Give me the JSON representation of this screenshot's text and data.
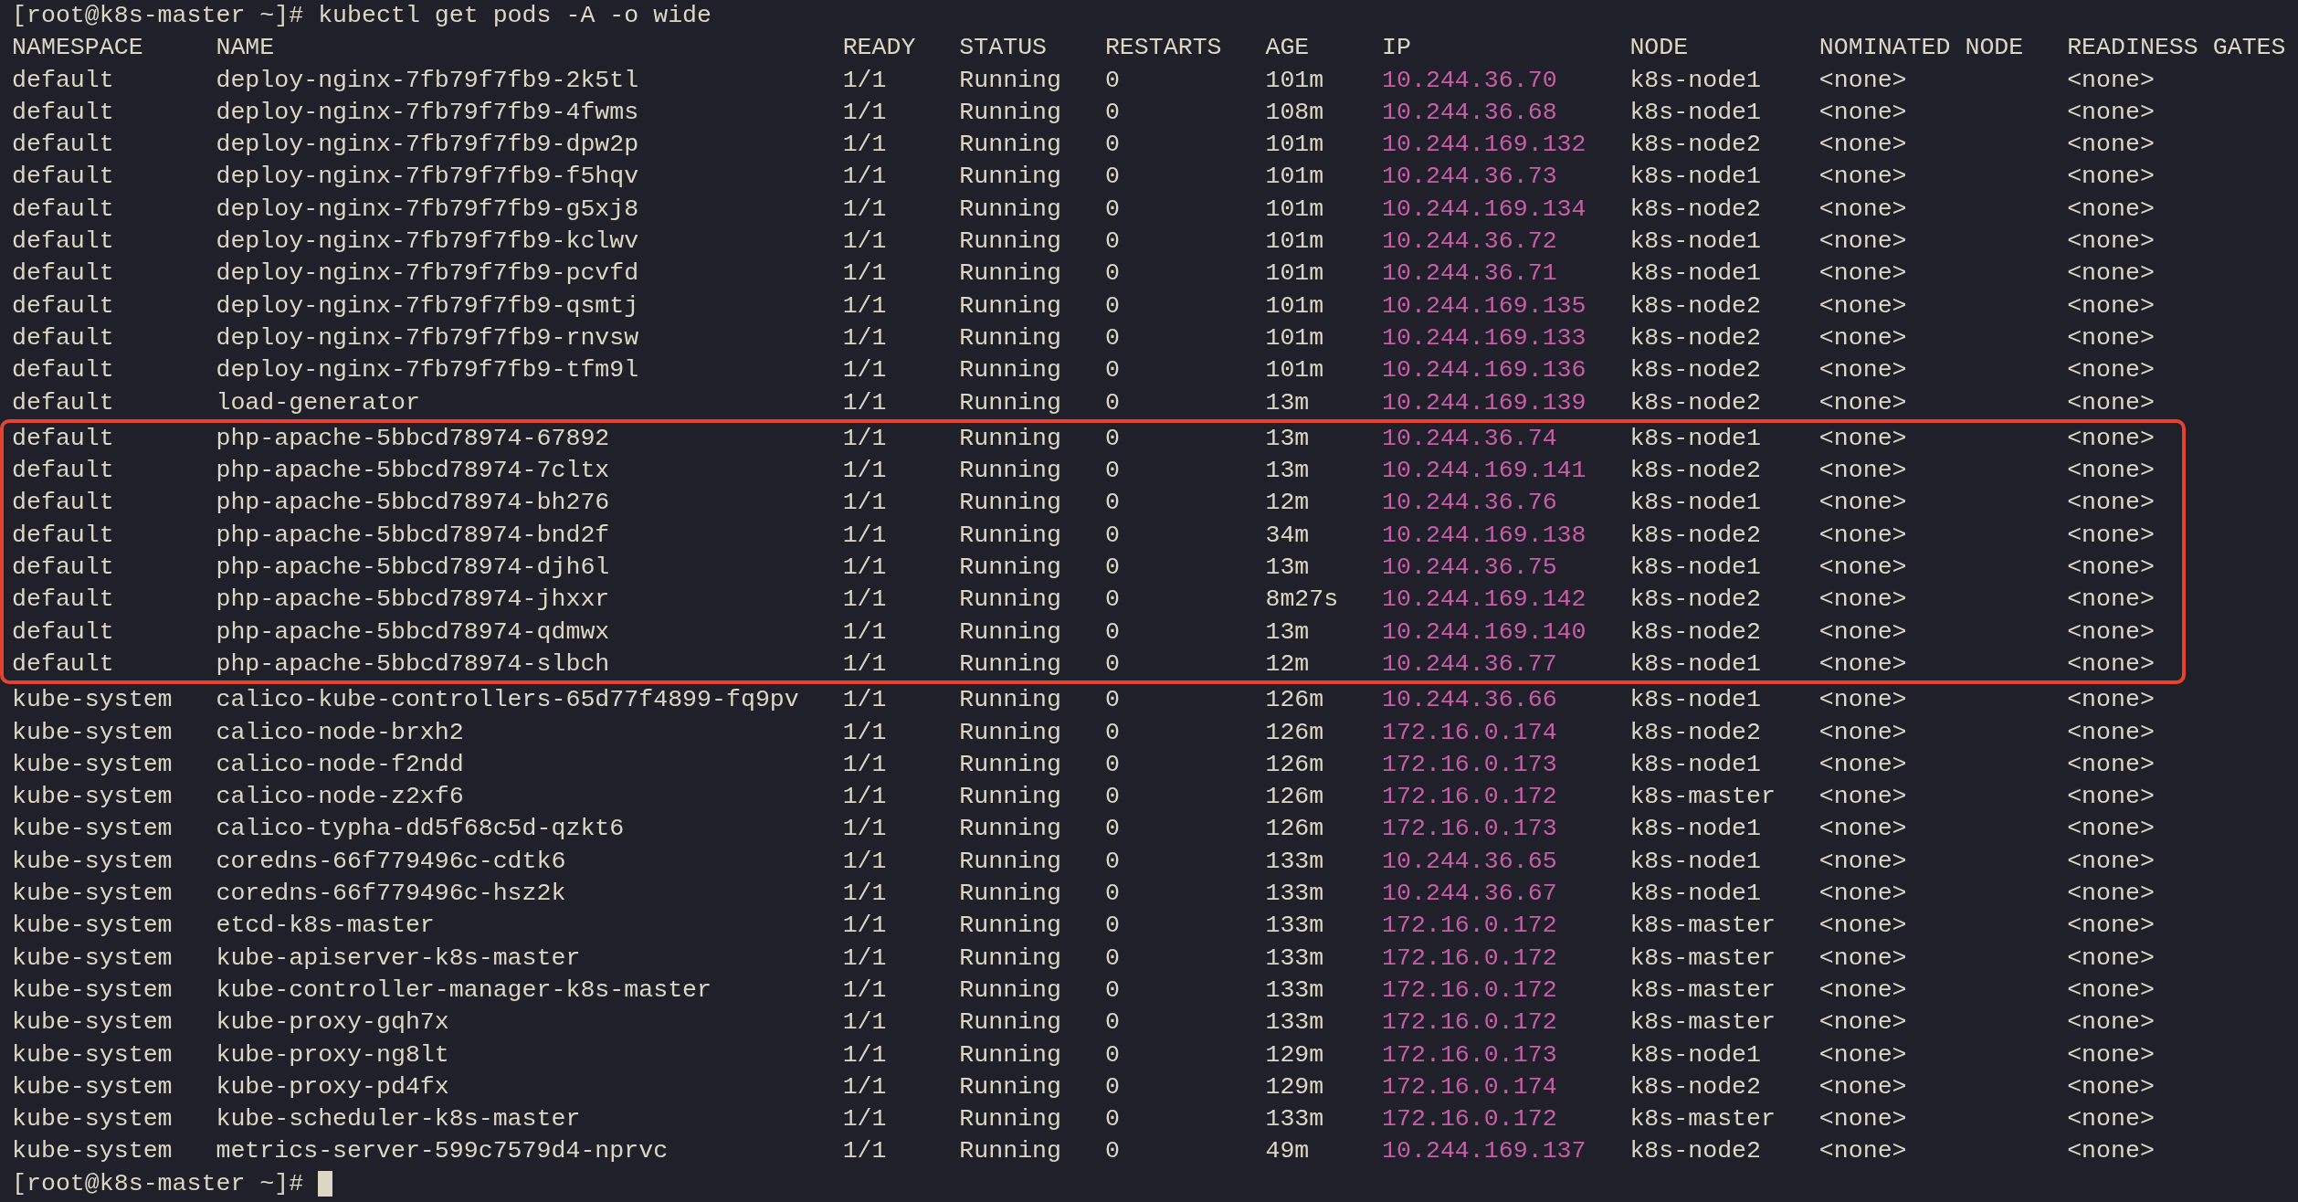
{
  "terminal": {
    "command_line": {
      "prompt": "[root@k8s-master ~]#",
      "command": "kubectl get pods -A -o wide"
    },
    "table": {
      "columns": [
        {
          "label": "NAMESPACE",
          "kind": "text"
        },
        {
          "label": "NAME",
          "kind": "text"
        },
        {
          "label": "READY",
          "kind": "text"
        },
        {
          "label": "STATUS",
          "kind": "text"
        },
        {
          "label": "RESTARTS",
          "kind": "text"
        },
        {
          "label": "AGE",
          "kind": "text"
        },
        {
          "label": "IP",
          "kind": "address"
        },
        {
          "label": "NODE",
          "kind": "text"
        },
        {
          "label": "NOMINATED NODE",
          "kind": "text"
        },
        {
          "label": "READINESS GATES",
          "kind": "text"
        }
      ],
      "row_groups": [
        {
          "highlighted": false,
          "rows": [
            {
              "cells": [
                "default",
                "deploy-nginx-7fb79f7fb9-2k5tl",
                "1/1",
                "Running",
                "0",
                "101m",
                "10.244.36.70",
                "k8s-node1",
                "<none>",
                "<none>"
              ]
            },
            {
              "cells": [
                "default",
                "deploy-nginx-7fb79f7fb9-4fwms",
                "1/1",
                "Running",
                "0",
                "108m",
                "10.244.36.68",
                "k8s-node1",
                "<none>",
                "<none>"
              ]
            },
            {
              "cells": [
                "default",
                "deploy-nginx-7fb79f7fb9-dpw2p",
                "1/1",
                "Running",
                "0",
                "101m",
                "10.244.169.132",
                "k8s-node2",
                "<none>",
                "<none>"
              ]
            },
            {
              "cells": [
                "default",
                "deploy-nginx-7fb79f7fb9-f5hqv",
                "1/1",
                "Running",
                "0",
                "101m",
                "10.244.36.73",
                "k8s-node1",
                "<none>",
                "<none>"
              ]
            },
            {
              "cells": [
                "default",
                "deploy-nginx-7fb79f7fb9-g5xj8",
                "1/1",
                "Running",
                "0",
                "101m",
                "10.244.169.134",
                "k8s-node2",
                "<none>",
                "<none>"
              ]
            },
            {
              "cells": [
                "default",
                "deploy-nginx-7fb79f7fb9-kclwv",
                "1/1",
                "Running",
                "0",
                "101m",
                "10.244.36.72",
                "k8s-node1",
                "<none>",
                "<none>"
              ]
            },
            {
              "cells": [
                "default",
                "deploy-nginx-7fb79f7fb9-pcvfd",
                "1/1",
                "Running",
                "0",
                "101m",
                "10.244.36.71",
                "k8s-node1",
                "<none>",
                "<none>"
              ]
            },
            {
              "cells": [
                "default",
                "deploy-nginx-7fb79f7fb9-qsmtj",
                "1/1",
                "Running",
                "0",
                "101m",
                "10.244.169.135",
                "k8s-node2",
                "<none>",
                "<none>"
              ]
            },
            {
              "cells": [
                "default",
                "deploy-nginx-7fb79f7fb9-rnvsw",
                "1/1",
                "Running",
                "0",
                "101m",
                "10.244.169.133",
                "k8s-node2",
                "<none>",
                "<none>"
              ]
            },
            {
              "cells": [
                "default",
                "deploy-nginx-7fb79f7fb9-tfm9l",
                "1/1",
                "Running",
                "0",
                "101m",
                "10.244.169.136",
                "k8s-node2",
                "<none>",
                "<none>"
              ]
            },
            {
              "cells": [
                "default",
                "load-generator",
                "1/1",
                "Running",
                "0",
                "13m",
                "10.244.169.139",
                "k8s-node2",
                "<none>",
                "<none>"
              ]
            }
          ]
        },
        {
          "highlighted": true,
          "rows": [
            {
              "cells": [
                "default",
                "php-apache-5bbcd78974-67892",
                "1/1",
                "Running",
                "0",
                "13m",
                "10.244.36.74",
                "k8s-node1",
                "<none>",
                "<none>"
              ]
            },
            {
              "cells": [
                "default",
                "php-apache-5bbcd78974-7cltx",
                "1/1",
                "Running",
                "0",
                "13m",
                "10.244.169.141",
                "k8s-node2",
                "<none>",
                "<none>"
              ]
            },
            {
              "cells": [
                "default",
                "php-apache-5bbcd78974-bh276",
                "1/1",
                "Running",
                "0",
                "12m",
                "10.244.36.76",
                "k8s-node1",
                "<none>",
                "<none>"
              ]
            },
            {
              "cells": [
                "default",
                "php-apache-5bbcd78974-bnd2f",
                "1/1",
                "Running",
                "0",
                "34m",
                "10.244.169.138",
                "k8s-node2",
                "<none>",
                "<none>"
              ]
            },
            {
              "cells": [
                "default",
                "php-apache-5bbcd78974-djh6l",
                "1/1",
                "Running",
                "0",
                "13m",
                "10.244.36.75",
                "k8s-node1",
                "<none>",
                "<none>"
              ]
            },
            {
              "cells": [
                "default",
                "php-apache-5bbcd78974-jhxxr",
                "1/1",
                "Running",
                "0",
                "8m27s",
                "10.244.169.142",
                "k8s-node2",
                "<none>",
                "<none>"
              ]
            },
            {
              "cells": [
                "default",
                "php-apache-5bbcd78974-qdmwx",
                "1/1",
                "Running",
                "0",
                "13m",
                "10.244.169.140",
                "k8s-node2",
                "<none>",
                "<none>"
              ]
            },
            {
              "cells": [
                "default",
                "php-apache-5bbcd78974-slbch",
                "1/1",
                "Running",
                "0",
                "12m",
                "10.244.36.77",
                "k8s-node1",
                "<none>",
                "<none>"
              ]
            }
          ]
        },
        {
          "highlighted": false,
          "rows": [
            {
              "cells": [
                "kube-system",
                "calico-kube-controllers-65d77f4899-fq9pv",
                "1/1",
                "Running",
                "0",
                "126m",
                "10.244.36.66",
                "k8s-node1",
                "<none>",
                "<none>"
              ]
            },
            {
              "cells": [
                "kube-system",
                "calico-node-brxh2",
                "1/1",
                "Running",
                "0",
                "126m",
                "172.16.0.174",
                "k8s-node2",
                "<none>",
                "<none>"
              ]
            },
            {
              "cells": [
                "kube-system",
                "calico-node-f2ndd",
                "1/1",
                "Running",
                "0",
                "126m",
                "172.16.0.173",
                "k8s-node1",
                "<none>",
                "<none>"
              ]
            },
            {
              "cells": [
                "kube-system",
                "calico-node-z2xf6",
                "1/1",
                "Running",
                "0",
                "126m",
                "172.16.0.172",
                "k8s-master",
                "<none>",
                "<none>"
              ]
            },
            {
              "cells": [
                "kube-system",
                "calico-typha-dd5f68c5d-qzkt6",
                "1/1",
                "Running",
                "0",
                "126m",
                "172.16.0.173",
                "k8s-node1",
                "<none>",
                "<none>"
              ]
            },
            {
              "cells": [
                "kube-system",
                "coredns-66f779496c-cdtk6",
                "1/1",
                "Running",
                "0",
                "133m",
                "10.244.36.65",
                "k8s-node1",
                "<none>",
                "<none>"
              ]
            },
            {
              "cells": [
                "kube-system",
                "coredns-66f779496c-hsz2k",
                "1/1",
                "Running",
                "0",
                "133m",
                "10.244.36.67",
                "k8s-node1",
                "<none>",
                "<none>"
              ]
            },
            {
              "cells": [
                "kube-system",
                "etcd-k8s-master",
                "1/1",
                "Running",
                "0",
                "133m",
                "172.16.0.172",
                "k8s-master",
                "<none>",
                "<none>"
              ]
            },
            {
              "cells": [
                "kube-system",
                "kube-apiserver-k8s-master",
                "1/1",
                "Running",
                "0",
                "133m",
                "172.16.0.172",
                "k8s-master",
                "<none>",
                "<none>"
              ]
            },
            {
              "cells": [
                "kube-system",
                "kube-controller-manager-k8s-master",
                "1/1",
                "Running",
                "0",
                "133m",
                "172.16.0.172",
                "k8s-master",
                "<none>",
                "<none>"
              ]
            },
            {
              "cells": [
                "kube-system",
                "kube-proxy-gqh7x",
                "1/1",
                "Running",
                "0",
                "133m",
                "172.16.0.172",
                "k8s-master",
                "<none>",
                "<none>"
              ]
            },
            {
              "cells": [
                "kube-system",
                "kube-proxy-ng8lt",
                "1/1",
                "Running",
                "0",
                "129m",
                "172.16.0.173",
                "k8s-node1",
                "<none>",
                "<none>"
              ]
            },
            {
              "cells": [
                "kube-system",
                "kube-proxy-pd4fx",
                "1/1",
                "Running",
                "0",
                "129m",
                "172.16.0.174",
                "k8s-node2",
                "<none>",
                "<none>"
              ]
            },
            {
              "cells": [
                "kube-system",
                "kube-scheduler-k8s-master",
                "1/1",
                "Running",
                "0",
                "133m",
                "172.16.0.172",
                "k8s-master",
                "<none>",
                "<none>"
              ]
            },
            {
              "cells": [
                "kube-system",
                "metrics-server-599c7579d4-nprvc",
                "1/1",
                "Running",
                "0",
                "49m",
                "10.244.169.137",
                "k8s-node2",
                "<none>",
                "<none>"
              ]
            }
          ]
        }
      ]
    },
    "prompt_line": {
      "prompt": "[root@k8s-master ~]#",
      "cursor": true
    }
  }
}
